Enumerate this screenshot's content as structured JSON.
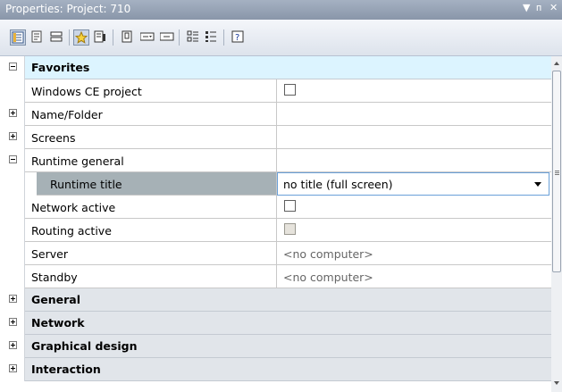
{
  "window": {
    "title": "Properties: Project: 710",
    "controls": {
      "dropdown": "▼",
      "pin": "ᴨ",
      "close": "✕"
    }
  },
  "toolbar": {
    "buttons": [
      {
        "name": "properties-grid-icon",
        "active": true
      },
      {
        "name": "page-icon",
        "active": false
      },
      {
        "name": "layout-icon",
        "active": false
      },
      {
        "name": "favorite-star-icon",
        "active": true
      },
      {
        "name": "property-page-icon",
        "active": false
      },
      {
        "name": "book-icon",
        "active": false
      },
      {
        "name": "input-field-icon",
        "active": false
      },
      {
        "name": "input-field-alt-icon",
        "active": false
      },
      {
        "name": "categorized-icon",
        "active": false
      },
      {
        "name": "alphabetical-icon",
        "active": false
      },
      {
        "name": "help-icon",
        "active": false
      }
    ]
  },
  "properties": {
    "favorites_label": "Favorites",
    "windows_ce_label": "Windows CE project",
    "name_folder_label": "Name/Folder",
    "screens_label": "Screens",
    "runtime_general_label": "Runtime general",
    "runtime_title_label": "Runtime title",
    "runtime_title_value": "no title (full screen)",
    "network_active_label": "Network active",
    "routing_active_label": "Routing active",
    "server_label": "Server",
    "server_value": "<no computer>",
    "standby_label": "Standby",
    "standby_value": "<no computer>",
    "general_label": "General",
    "network_label": "Network",
    "graphical_design_label": "Graphical design",
    "interaction_label": "Interaction"
  },
  "colors": {
    "titlebar": "#8e9bb0",
    "favorites_bg": "#dcf4ff",
    "category_bg": "#e1e5ea",
    "selected_name_bg": "#a6b1b6",
    "dropdown_border": "#6aa0d8"
  }
}
